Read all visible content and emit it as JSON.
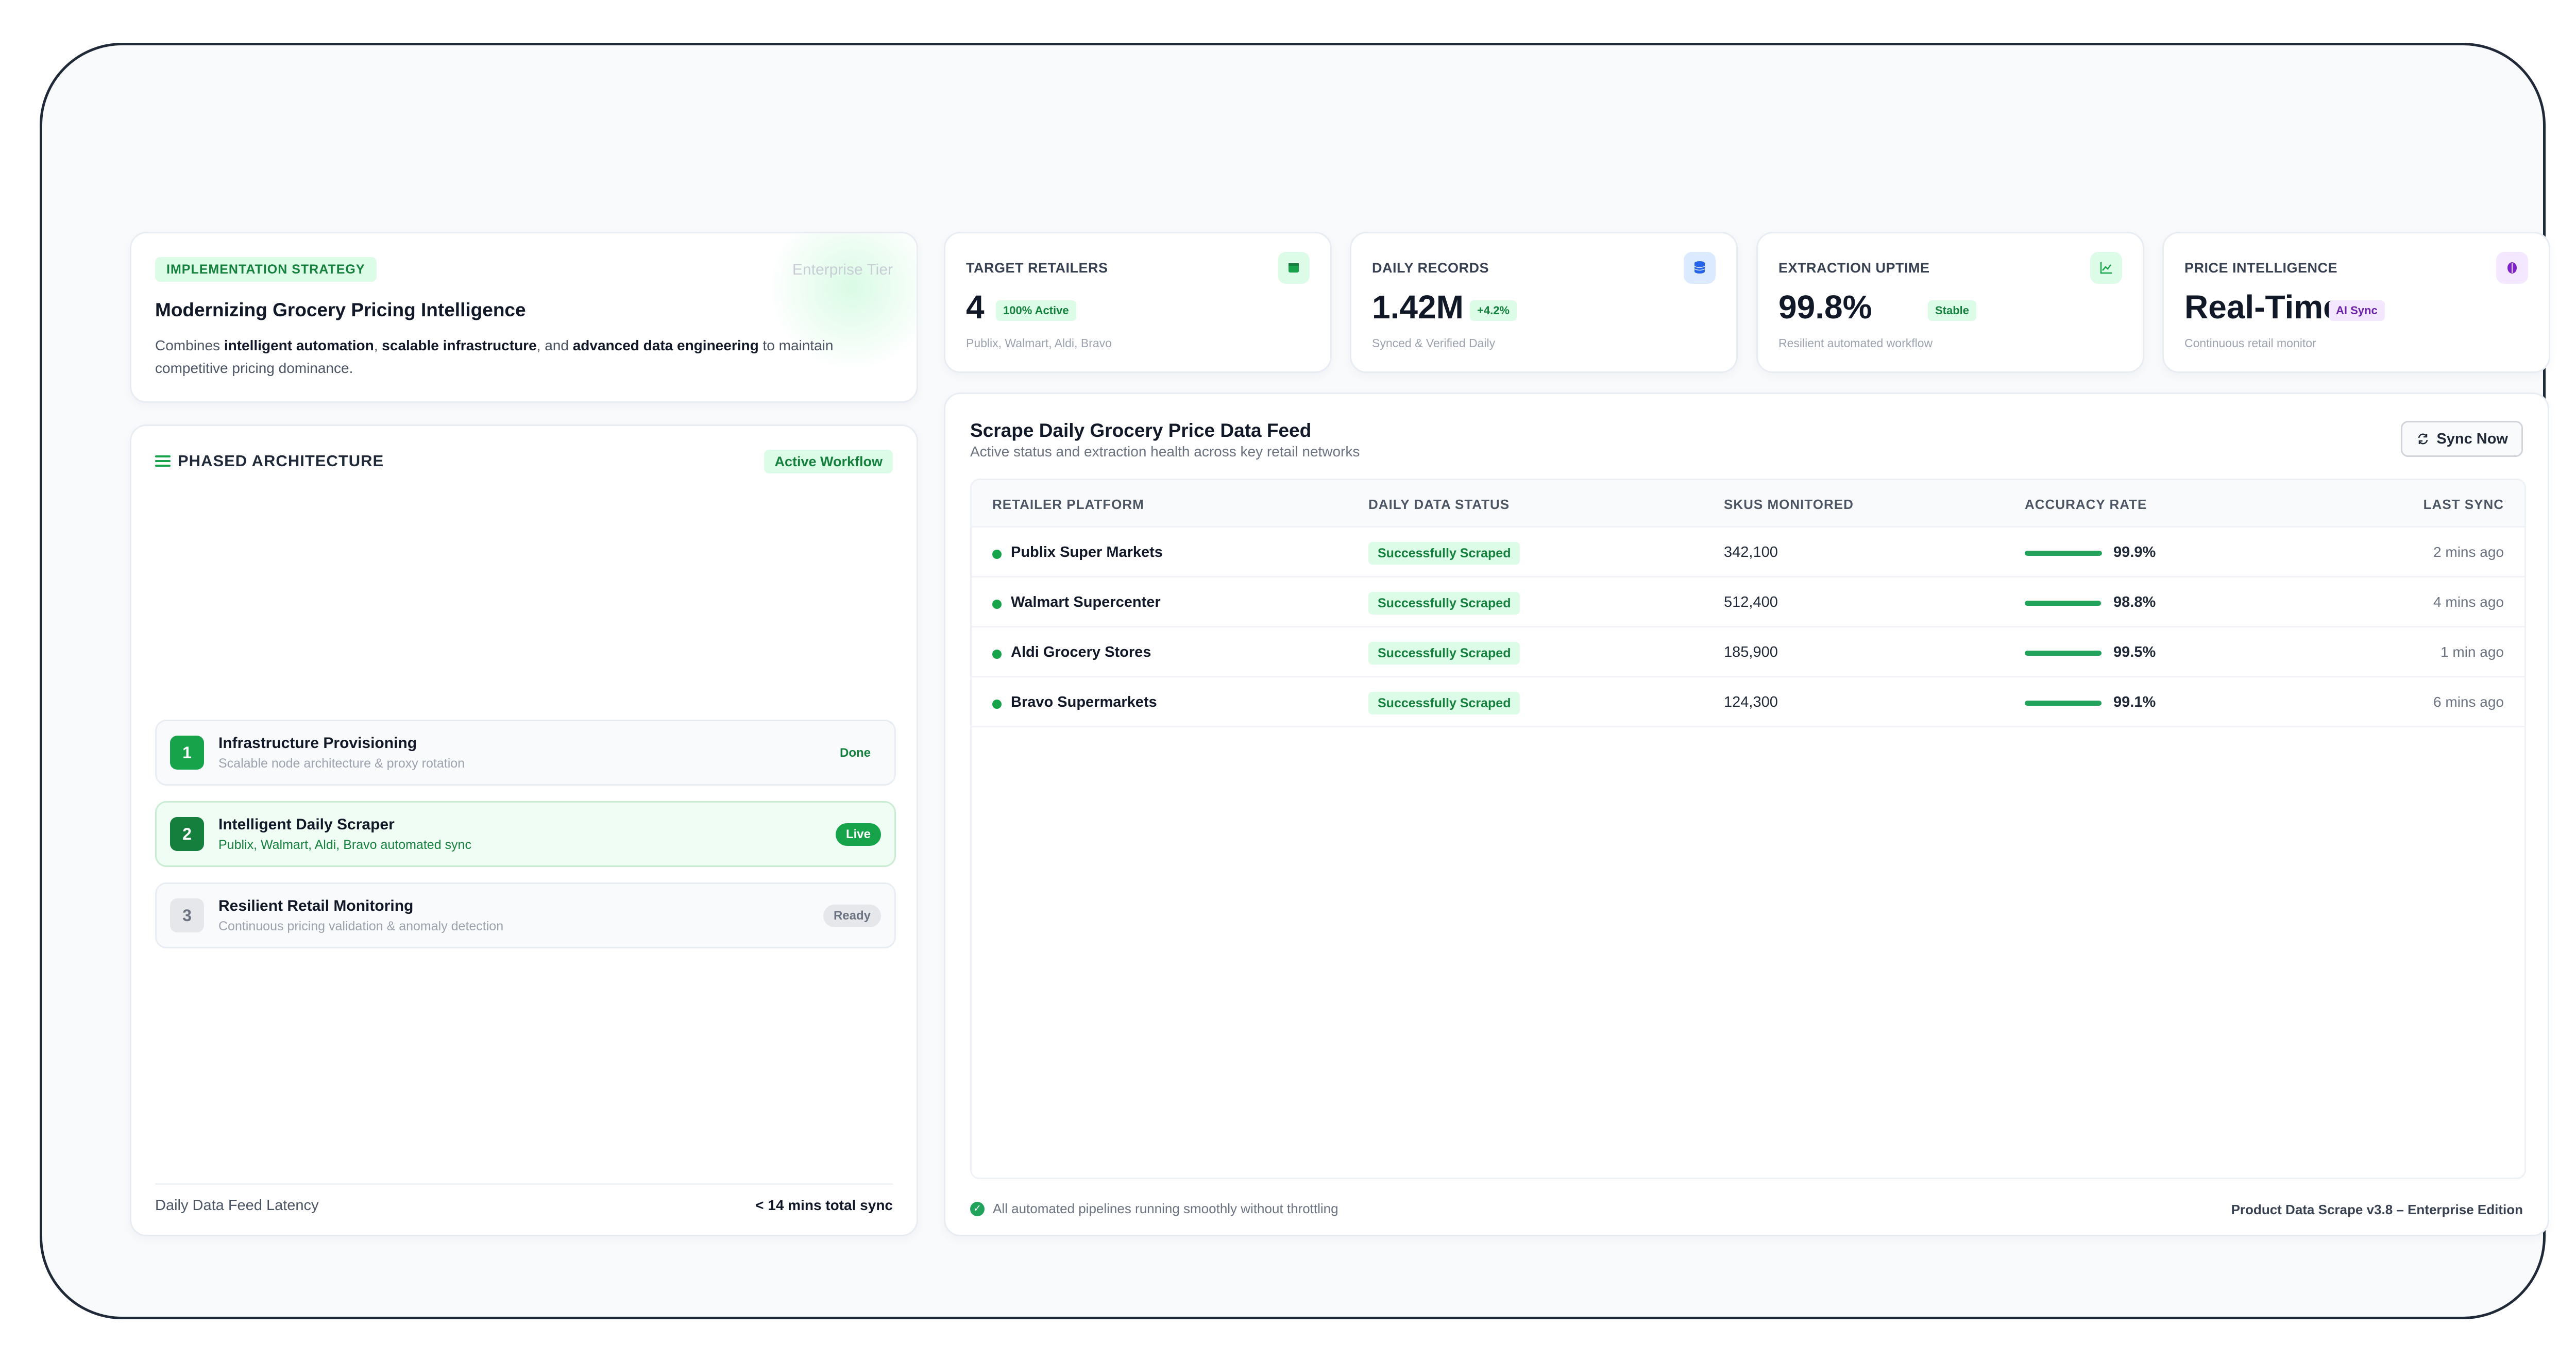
{
  "strategy": {
    "tag": "IMPLEMENTATION STRATEGY",
    "tier": "Enterprise Tier",
    "title": "Modernizing Grocery Pricing Intelligence",
    "desc_1": "Combines ",
    "desc_b1": "intelligent automation",
    "desc_2": ", ",
    "desc_b2": "scalable infrastructure",
    "desc_3": ", and ",
    "desc_b3": "advanced data engineering",
    "desc_4": " to maintain competitive pricing dominance."
  },
  "architecture": {
    "title": "PHASED ARCHITECTURE",
    "badge": "Active Workflow",
    "phases": [
      {
        "num": "1",
        "title": "Infrastructure Provisioning",
        "sub": "Scalable node architecture & proxy rotation",
        "status": "Done"
      },
      {
        "num": "2",
        "title": "Intelligent Daily Scraper",
        "sub": "Publix, Walmart, Aldi, Bravo automated sync",
        "status": "Live"
      },
      {
        "num": "3",
        "title": "Resilient Retail Monitoring",
        "sub": "Continuous pricing validation & anomaly detection",
        "status": "Ready"
      }
    ],
    "latency_label": "Daily Data Feed Latency",
    "latency_value": "< 14 mins total sync"
  },
  "kpis": [
    {
      "label": "TARGET RETAILERS",
      "value": "4",
      "badge": "100% Active",
      "sub": "Publix, Walmart, Aldi, Bravo",
      "icon": "store-icon"
    },
    {
      "label": "DAILY RECORDS",
      "value": "1.42M",
      "badge": "+4.2%",
      "sub": "Synced & Verified Daily",
      "icon": "database-icon"
    },
    {
      "label": "EXTRACTION UPTIME",
      "value": "99.8%",
      "badge": "Stable",
      "sub": "Resilient automated workflow",
      "icon": "chart-line-icon"
    },
    {
      "label": "PRICE INTELLIGENCE",
      "value": "Real-Time",
      "badge": "AI Sync",
      "sub": "Continuous retail monitor",
      "icon": "brain-icon"
    }
  ],
  "feed": {
    "title": "Scrape Daily Grocery Price Data Feed",
    "subtitle": "Active status and extraction health across key retail networks",
    "sync_label": "Sync Now",
    "columns": [
      "RETAILER PLATFORM",
      "DAILY DATA STATUS",
      "SKUS MONITORED",
      "ACCURACY RATE",
      "LAST SYNC"
    ],
    "rows": [
      {
        "name": "Publix Super Markets",
        "status": "Successfully Scraped",
        "skus": "342,100",
        "accuracy": "99.9%",
        "accuracy_value": 0.999,
        "last": "2 mins ago"
      },
      {
        "name": "Walmart Supercenter",
        "status": "Successfully Scraped",
        "skus": "512,400",
        "accuracy": "98.8%",
        "accuracy_value": 0.988,
        "last": "4 mins ago"
      },
      {
        "name": "Aldi Grocery Stores",
        "status": "Successfully Scraped",
        "skus": "185,900",
        "accuracy": "99.5%",
        "accuracy_value": 0.995,
        "last": "1 min ago"
      },
      {
        "name": "Bravo Supermarkets",
        "status": "Successfully Scraped",
        "skus": "124,300",
        "accuracy": "99.1%",
        "accuracy_value": 0.991,
        "last": "6 mins ago"
      }
    ],
    "footer_status": "All automated pipelines running smoothly without throttling",
    "footer_version": "Product Data Scrape v3.8 – Enterprise Edition"
  },
  "colors": {
    "accent": "#16a34a",
    "accent_light": "#dcfce7",
    "purple": "#6b21a8",
    "blue": "#2563eb"
  }
}
